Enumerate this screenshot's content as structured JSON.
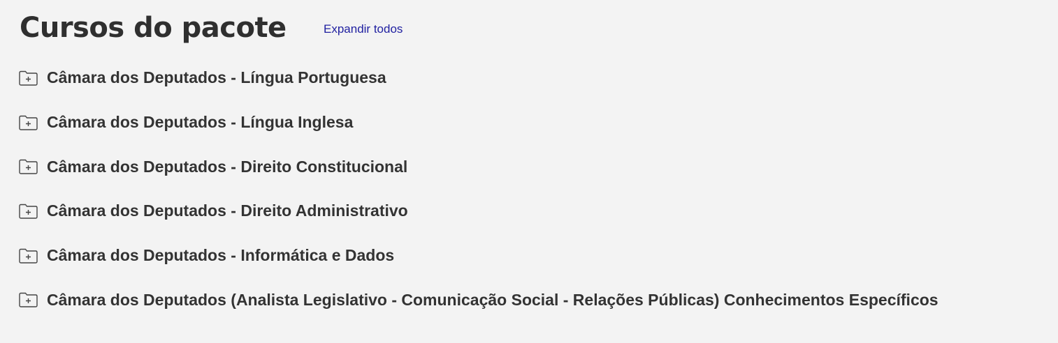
{
  "header": {
    "title": "Cursos do pacote",
    "expand_all_label": "Expandir todos"
  },
  "courses": [
    {
      "label": "Câmara dos Deputados - Língua Portuguesa",
      "icon": "folder-plus-icon"
    },
    {
      "label": "Câmara dos Deputados - Língua Inglesa",
      "icon": "folder-plus-icon"
    },
    {
      "label": "Câmara dos Deputados - Direito Constitucional",
      "icon": "folder-plus-icon"
    },
    {
      "label": "Câmara dos Deputados - Direito Administrativo",
      "icon": "folder-plus-icon"
    },
    {
      "label": "Câmara dos Deputados - Informática e Dados",
      "icon": "folder-plus-icon"
    },
    {
      "label": "Câmara dos Deputados (Analista Legislativo - Comunicação Social - Relações Públicas) Conhecimentos Específicos",
      "icon": "folder-plus-icon"
    }
  ],
  "colors": {
    "background": "#f3f3f3",
    "text": "#333333",
    "link": "#1f1fa0"
  }
}
